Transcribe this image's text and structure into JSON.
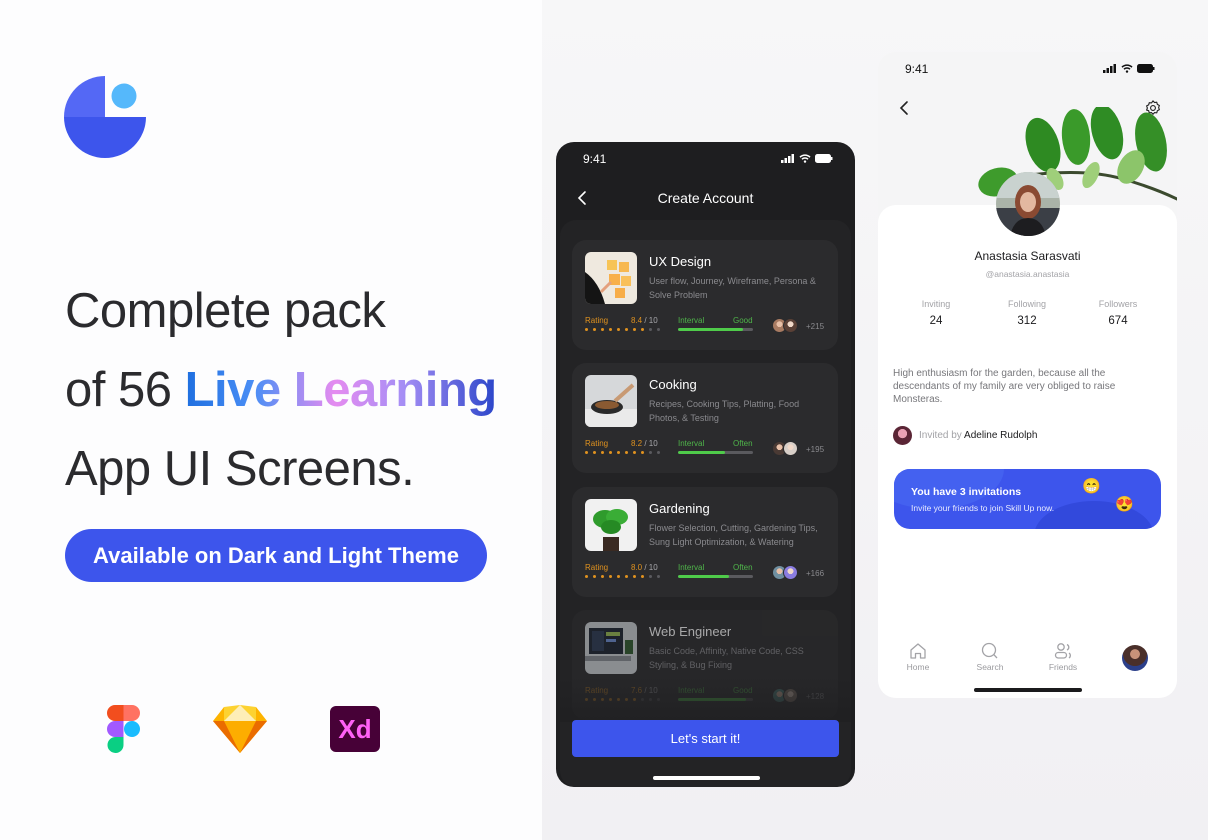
{
  "hero": {
    "headline_line1": "Complete pack",
    "headline_line2_prefix": "of 56 ",
    "headline_line2_highlight": "Live Learning",
    "headline_line3": "App UI Screens.",
    "theme_pill": "Available on Dark and Light Theme"
  },
  "brand": {
    "logo": "pie-chart-logo",
    "accent": "#3d55ec"
  },
  "tools": [
    {
      "name": "Figma",
      "icon": "figma-icon"
    },
    {
      "name": "Sketch",
      "icon": "sketch-icon"
    },
    {
      "name": "Adobe XD",
      "icon": "adobe-xd-icon",
      "label": "Xd"
    }
  ],
  "dark_screen": {
    "status_time": "9:41",
    "title": "Create Account",
    "courses": [
      {
        "title": "UX Design",
        "desc": "User flow, Journey, Wireframe, Persona & Solve Problem",
        "rating_label": "Rating",
        "rating": "8.4",
        "rating_max": " / 10",
        "rating_dots": 8,
        "interval_label": "Interval",
        "interval": "Good",
        "progress": 0.86,
        "count": "+215"
      },
      {
        "title": "Cooking",
        "desc": "Recipes, Cooking Tips, Platting, Food Photos, & Testing",
        "rating_label": "Rating",
        "rating": "8.2",
        "rating_max": " / 10",
        "rating_dots": 8,
        "interval_label": "Interval",
        "interval": "Often",
        "progress": 0.62,
        "count": "+195"
      },
      {
        "title": "Gardening",
        "desc": "Flower Selection, Cutting, Gardening Tips, Sung Light Optimization, & Watering",
        "rating_label": "Rating",
        "rating": "8.0",
        "rating_max": " / 10",
        "rating_dots": 8,
        "interval_label": "Interval",
        "interval": "Often",
        "progress": 0.68,
        "count": "+166"
      },
      {
        "title": "Web Engineer",
        "desc": "Basic Code, Affinity, Native Code, CSS Styling, & Bug Fixing",
        "rating_label": "Rating",
        "rating": "7.6",
        "rating_max": " / 10",
        "rating_dots": 7,
        "interval_label": "Interval",
        "interval": "Good",
        "progress": 0.9,
        "count": "+128"
      }
    ],
    "cta": "Let's start it!"
  },
  "light_screen": {
    "status_time": "9:41",
    "profile": {
      "name": "Anastasia Sarasvati",
      "handle": "@anastasia.anastasia",
      "stats": [
        {
          "label": "Inviting",
          "value": "24"
        },
        {
          "label": "Following",
          "value": "312"
        },
        {
          "label": "Followers",
          "value": "674"
        }
      ],
      "bio": "High enthusiasm for the garden, because all the descendants of my family are very obliged to raise Monsteras.",
      "invited_prefix": "Invited by ",
      "invited_by": "Adeline Rudolph"
    },
    "invite_card": {
      "title": "You have 3 invitations",
      "subtitle": "Invite your friends to join Skill Up now.",
      "emoji1": "😁",
      "emoji2": "😍"
    },
    "tabs": [
      {
        "label": "Home",
        "icon": "home-icon"
      },
      {
        "label": "Search",
        "icon": "search-icon"
      },
      {
        "label": "Friends",
        "icon": "friends-icon"
      }
    ]
  }
}
